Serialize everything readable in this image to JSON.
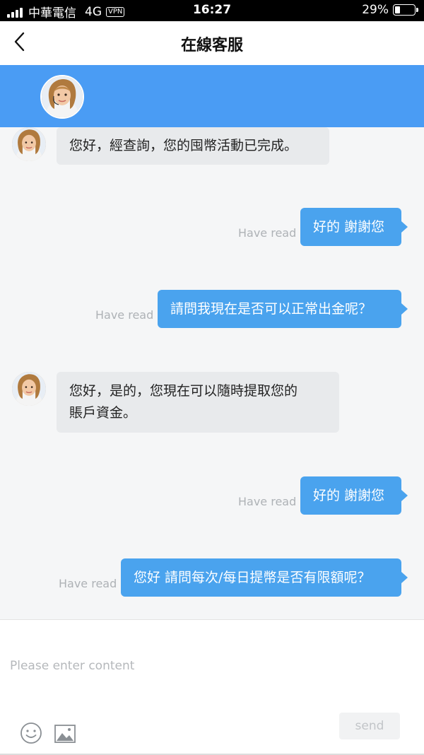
{
  "status_bar": {
    "carrier": "中華電信",
    "network": "4G",
    "vpn": "VPN",
    "time": "16:27",
    "battery": "29%",
    "battery_level": 0.29
  },
  "nav": {
    "title": "在線客服",
    "back_icon": "chevron-left-icon"
  },
  "messages": [
    {
      "from": "agent",
      "text_lines": [
        "您好，經查詢，您的囤幣活動已完成。"
      ]
    },
    {
      "from": "user",
      "text": "好的 謝謝您",
      "read_status": "Have read"
    },
    {
      "from": "user",
      "text": "請問我現在是否可以正常出金呢？",
      "read_status": "Have read"
    },
    {
      "from": "agent",
      "text_lines": [
        "您好，是的，您現在可以隨時提取您的",
        "賬戶資金。"
      ]
    },
    {
      "from": "user",
      "text": "好的 謝謝您",
      "read_status": "Have read"
    },
    {
      "from": "user",
      "text": "您好 請問每次/每日提幣是否有限額呢？",
      "read_status": "Have read"
    }
  ],
  "composer": {
    "placeholder": "Please enter content",
    "send_label": "send",
    "emoji_icon": "smiley-icon",
    "image_icon": "image-icon"
  },
  "colors": {
    "header_blue": "#4a9cf4",
    "user_bubble": "#4aa3ee",
    "agent_bubble": "#e8eaec"
  }
}
